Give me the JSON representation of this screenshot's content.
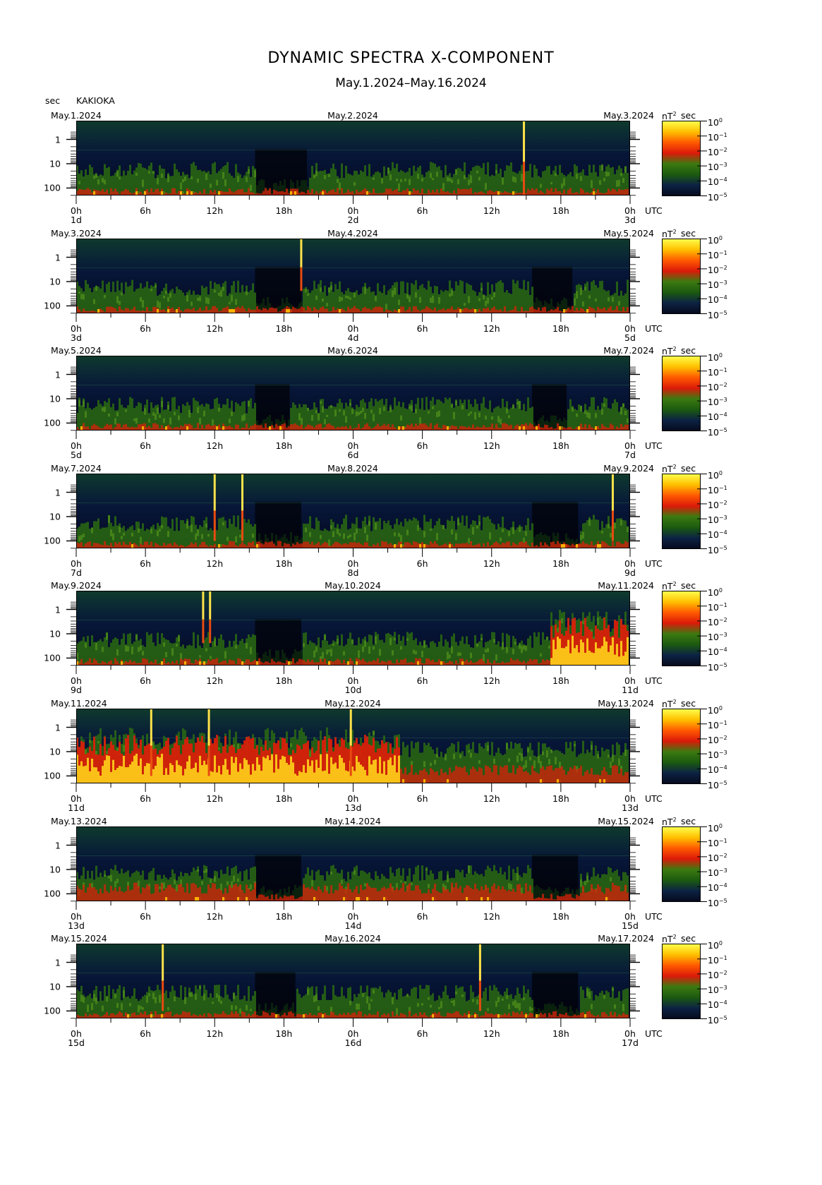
{
  "header": {
    "title": "DYNAMIC SPECTRA X-COMPONENT",
    "subtitle": "May.1.2024–May.16.2024",
    "y_unit": "sec",
    "station": "KAKIOKA"
  },
  "colorbar": {
    "unit_base": "nT",
    "unit_exp": "2",
    "unit_suffix": "sec",
    "ticks": [
      {
        "base": "10",
        "exp": "0"
      },
      {
        "base": "10",
        "exp": "−1"
      },
      {
        "base": "10",
        "exp": "−2"
      },
      {
        "base": "10",
        "exp": "−3"
      },
      {
        "base": "10",
        "exp": "−4"
      },
      {
        "base": "10",
        "exp": "−5"
      }
    ],
    "colors": [
      "#ffff4d",
      "#ffc000",
      "#ff5a00",
      "#dc1a0a",
      "#3c7a10",
      "#1c5a10",
      "#0c2244",
      "#060a1c"
    ]
  },
  "x_axis": {
    "tick_labels": [
      "0h",
      "6h",
      "12h",
      "18h",
      "0h",
      "6h",
      "12h",
      "18h",
      "0h"
    ],
    "utc_label": "UTC"
  },
  "y_axis": {
    "tick_labels": [
      "1",
      "10",
      "100"
    ]
  },
  "chart_data": [
    {
      "type": "heatmap",
      "date_left": "May.1.2024",
      "date_mid": "May.2.2024",
      "date_right": "May.3.2024",
      "day_left": "1d",
      "day_mid": "2d",
      "day_right": "3d",
      "x_range_hours": [
        0,
        48
      ],
      "y_ticks_sec": [
        1,
        10,
        100
      ],
      "activity": 1,
      "quiet": [
        [
          15.5,
          20
        ]
      ],
      "spikes": [
        [
          38.8,
          1.0
        ]
      ],
      "storm": []
    },
    {
      "type": "heatmap",
      "date_left": "May.3.2024",
      "date_mid": "May.4.2024",
      "date_right": "May.5.2024",
      "day_left": "3d",
      "day_mid": "4d",
      "day_right": "5d",
      "x_range_hours": [
        0,
        48
      ],
      "y_ticks_sec": [
        1,
        10,
        100
      ],
      "activity": 1,
      "quiet": [
        [
          15.5,
          19.5
        ],
        [
          39.5,
          43
        ]
      ],
      "spikes": [
        [
          19.5,
          0.7
        ]
      ],
      "storm": []
    },
    {
      "type": "heatmap",
      "date_left": "May.5.2024",
      "date_mid": "May.6.2024",
      "date_right": "May.7.2024",
      "day_left": "5d",
      "day_mid": "6d",
      "day_right": "7d",
      "x_range_hours": [
        0,
        48
      ],
      "y_ticks_sec": [
        1,
        10,
        100
      ],
      "activity": 1,
      "quiet": [
        [
          15.5,
          18.5
        ],
        [
          39.5,
          42.5
        ]
      ],
      "spikes": [],
      "storm": []
    },
    {
      "type": "heatmap",
      "date_left": "May.7.2024",
      "date_mid": "May.8.2024",
      "date_right": "May.9.2024",
      "day_left": "7d",
      "day_mid": "8d",
      "day_right": "9d",
      "x_range_hours": [
        0,
        48
      ],
      "y_ticks_sec": [
        1,
        10,
        100
      ],
      "activity": 1,
      "quiet": [
        [
          15.5,
          19.5
        ],
        [
          39.5,
          43.5
        ]
      ],
      "spikes": [
        [
          12,
          0.9
        ],
        [
          14.4,
          0.9
        ],
        [
          46.5,
          0.9
        ]
      ],
      "storm": []
    },
    {
      "type": "heatmap",
      "date_left": "May.9.2024",
      "date_mid": "May.10.2024",
      "date_right": "May.11.2024",
      "day_left": "9d",
      "day_mid": "10d",
      "day_right": "11d",
      "x_range_hours": [
        0,
        48
      ],
      "y_ticks_sec": [
        1,
        10,
        100
      ],
      "activity": 1,
      "quiet": [
        [
          15.5,
          19.5
        ]
      ],
      "spikes": [
        [
          11,
          0.7
        ],
        [
          11.6,
          0.7
        ]
      ],
      "storm": [
        [
          41,
          48
        ]
      ]
    },
    {
      "type": "heatmap",
      "date_left": "May.11.2024",
      "date_mid": "May.12.2024",
      "date_right": "May.13.2024",
      "day_left": "11d",
      "day_mid": "13d",
      "day_right": "13d",
      "x_range_hours": [
        0,
        48
      ],
      "y_ticks_sec": [
        1,
        10,
        100
      ],
      "activity": 2,
      "quiet": [],
      "spikes": [
        [
          6.5,
          0.9
        ],
        [
          11.5,
          0.9
        ],
        [
          23.8,
          0.9
        ]
      ],
      "storm": [
        [
          0,
          28
        ]
      ]
    },
    {
      "type": "heatmap",
      "date_left": "May.13.2024",
      "date_mid": "May.14.2024",
      "date_right": "May.15.2024",
      "day_left": "13d",
      "day_mid": "14d",
      "day_right": "15d",
      "x_range_hours": [
        0,
        48
      ],
      "y_ticks_sec": [
        1,
        10,
        100
      ],
      "activity": 1.3,
      "quiet": [
        [
          15.5,
          19.5
        ],
        [
          39.5,
          43.5
        ]
      ],
      "spikes": [],
      "storm": []
    },
    {
      "type": "heatmap",
      "date_left": "May.15.2024",
      "date_mid": "May.16.2024",
      "date_right": "May.17.2024",
      "day_left": "15d",
      "day_mid": "16d",
      "day_right": "17d",
      "x_range_hours": [
        0,
        48
      ],
      "y_ticks_sec": [
        1,
        10,
        100
      ],
      "activity": 1,
      "quiet": [
        [
          15.5,
          19
        ],
        [
          39.5,
          43.5
        ]
      ],
      "spikes": [
        [
          7.5,
          0.9
        ],
        [
          35,
          0.9
        ]
      ],
      "storm": []
    }
  ]
}
